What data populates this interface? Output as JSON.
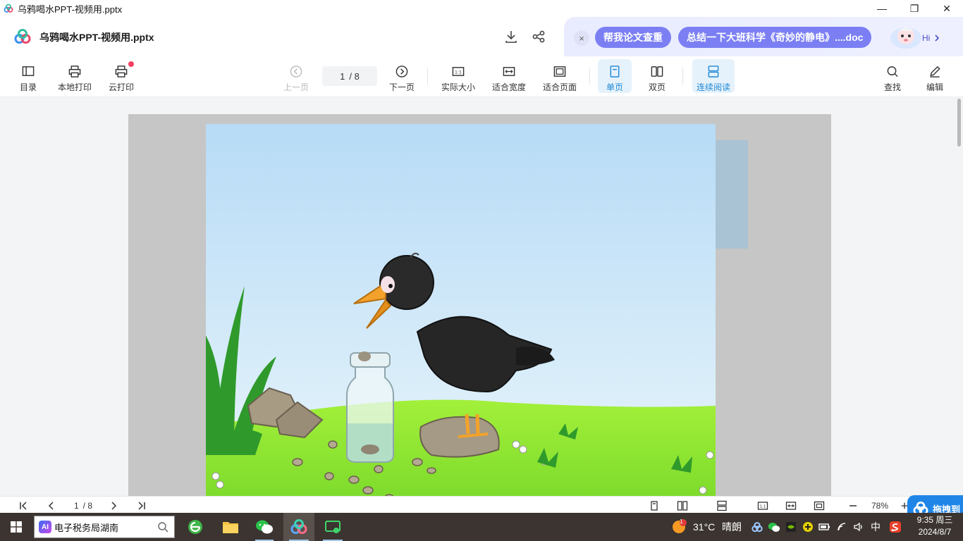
{
  "window": {
    "title": "乌鸦喝水PPT-视频用.pptx",
    "minimize": "—",
    "maximize": "❐",
    "close": "✕"
  },
  "header": {
    "doc_title": "乌鸦喝水PPT-视频用.pptx",
    "ai_close": "×",
    "chip1": "帮我论文查重",
    "chip2": "总结一下大班科学《奇妙的静电》....doc",
    "hi": "Hi"
  },
  "toolbar": {
    "toc": "目录",
    "local_print": "本地打印",
    "cloud_print": "云打印",
    "prev_page": "上一页",
    "page_current": "1",
    "page_total": "/ 8",
    "next_page": "下一页",
    "actual_size": "实际大小",
    "fit_width": "适合宽度",
    "fit_page": "适合页面",
    "single_page": "单页",
    "double_page": "双页",
    "continuous": "连续阅读",
    "find": "查找",
    "edit": "编辑",
    "actual_size_glyph": "1:1"
  },
  "bottombar": {
    "page_current": "1",
    "page_total": "/ 8",
    "zoom": "78%",
    "actual_size_glyph": "1:1",
    "float_label": "拖拽到"
  },
  "taskbar": {
    "search_text": "电子税务局湖南",
    "ai_badge": "AI",
    "weather_temp": "31°C",
    "weather_text": "晴朗",
    "weather_badge": "1",
    "ime": "中",
    "time": "9:35 周三",
    "date": "2024/8/7"
  },
  "colors": {
    "accent": "#1e88d6",
    "chip": "#7b7ff3",
    "taskbar": "#3b3430"
  }
}
